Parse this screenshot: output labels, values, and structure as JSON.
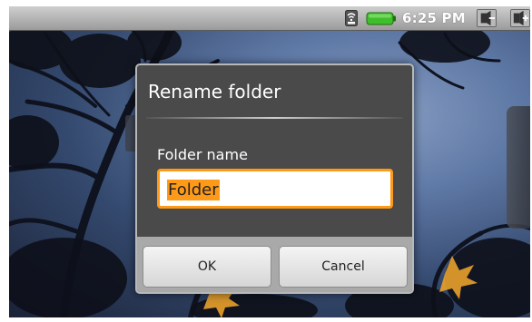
{
  "status_bar": {
    "time": "6:25 PM",
    "icons": [
      "wifi-icon",
      "battery-icon",
      "volume-down-icon",
      "volume-up-icon"
    ],
    "battery_color": "#3fbf2a"
  },
  "dialog": {
    "title": "Rename folder",
    "field_label": "Folder name",
    "input_value": "Folder",
    "input_selected": true,
    "accent_color": "#ff9a18",
    "ok_label": "OK",
    "cancel_label": "Cancel"
  }
}
